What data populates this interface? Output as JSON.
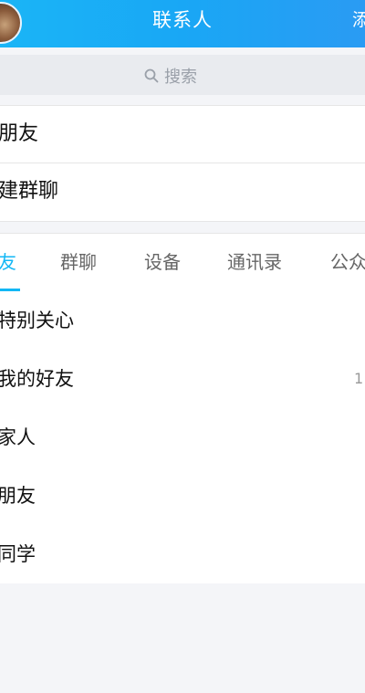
{
  "header": {
    "title": "联系人",
    "right_action": "添"
  },
  "search": {
    "placeholder": "搜索",
    "icon": "search-icon"
  },
  "top_rows": [
    {
      "label": "朋友"
    },
    {
      "label": "建群聊"
    }
  ],
  "tabs": [
    {
      "label": "友",
      "active": true
    },
    {
      "label": "群聊",
      "active": false
    },
    {
      "label": "设备",
      "active": false
    },
    {
      "label": "通讯录",
      "active": false
    },
    {
      "label": "公众",
      "active": false
    }
  ],
  "groups": [
    {
      "label": "特别关心",
      "count": ""
    },
    {
      "label": "我的好友",
      "count": "1"
    },
    {
      "label": "家人",
      "count": ""
    },
    {
      "label": "朋友",
      "count": ""
    },
    {
      "label": "同学",
      "count": ""
    }
  ],
  "colors": {
    "accent": "#12b7f5",
    "header_gradient_start": "#1ab5f6",
    "header_gradient_end": "#2a9bf3"
  }
}
